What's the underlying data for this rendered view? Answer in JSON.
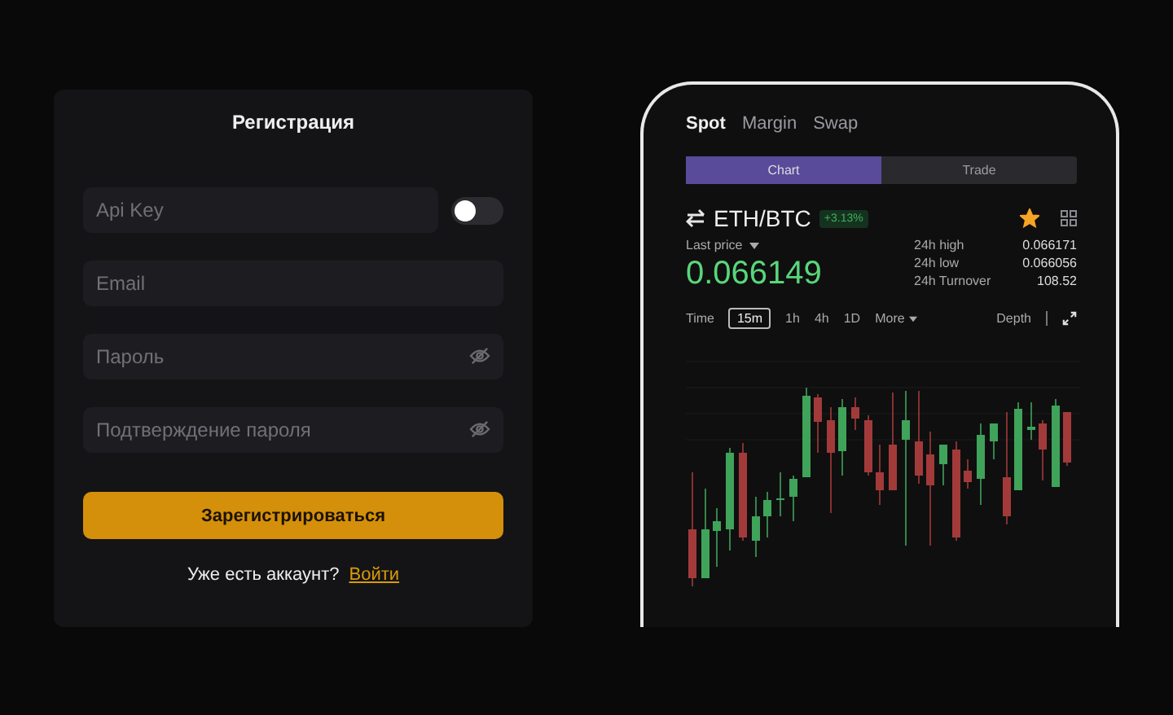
{
  "registration": {
    "title": "Регистрация",
    "fields": [
      {
        "kind": "toggle",
        "placeholder": "Api Key",
        "on": false
      },
      {
        "kind": "text",
        "placeholder": "Email"
      },
      {
        "kind": "password",
        "placeholder": "Пароль"
      },
      {
        "kind": "password",
        "placeholder": "Подтверждение пароля"
      }
    ],
    "submit": "Зарегистрироваться",
    "login_prompt": "Уже есть аккаунт?",
    "login_link": "Войти"
  },
  "phone": {
    "tabs": [
      {
        "label": "Spot",
        "selected": true
      },
      {
        "label": "Margin",
        "selected": false
      },
      {
        "label": "Swap",
        "selected": false
      }
    ],
    "segments": [
      {
        "label": "Chart",
        "selected": true
      },
      {
        "label": "Trade",
        "selected": false
      }
    ],
    "pair": "ETH/BTC",
    "change": "+3.13%",
    "favorite": true,
    "last_price_label": "Last price",
    "price": "0.066149",
    "stats": [
      {
        "label": "24h high",
        "value": "0.066171"
      },
      {
        "label": "24h low",
        "value": "0.066056"
      },
      {
        "label": "24h Turnover",
        "value": "108.52"
      }
    ],
    "intervals": [
      {
        "label": "Time",
        "selected": false
      },
      {
        "label": "15m",
        "selected": true
      },
      {
        "label": "1h",
        "selected": false
      },
      {
        "label": "4h",
        "selected": false
      },
      {
        "label": "1D",
        "selected": false
      }
    ],
    "more": "More",
    "depth": "Depth"
  }
}
